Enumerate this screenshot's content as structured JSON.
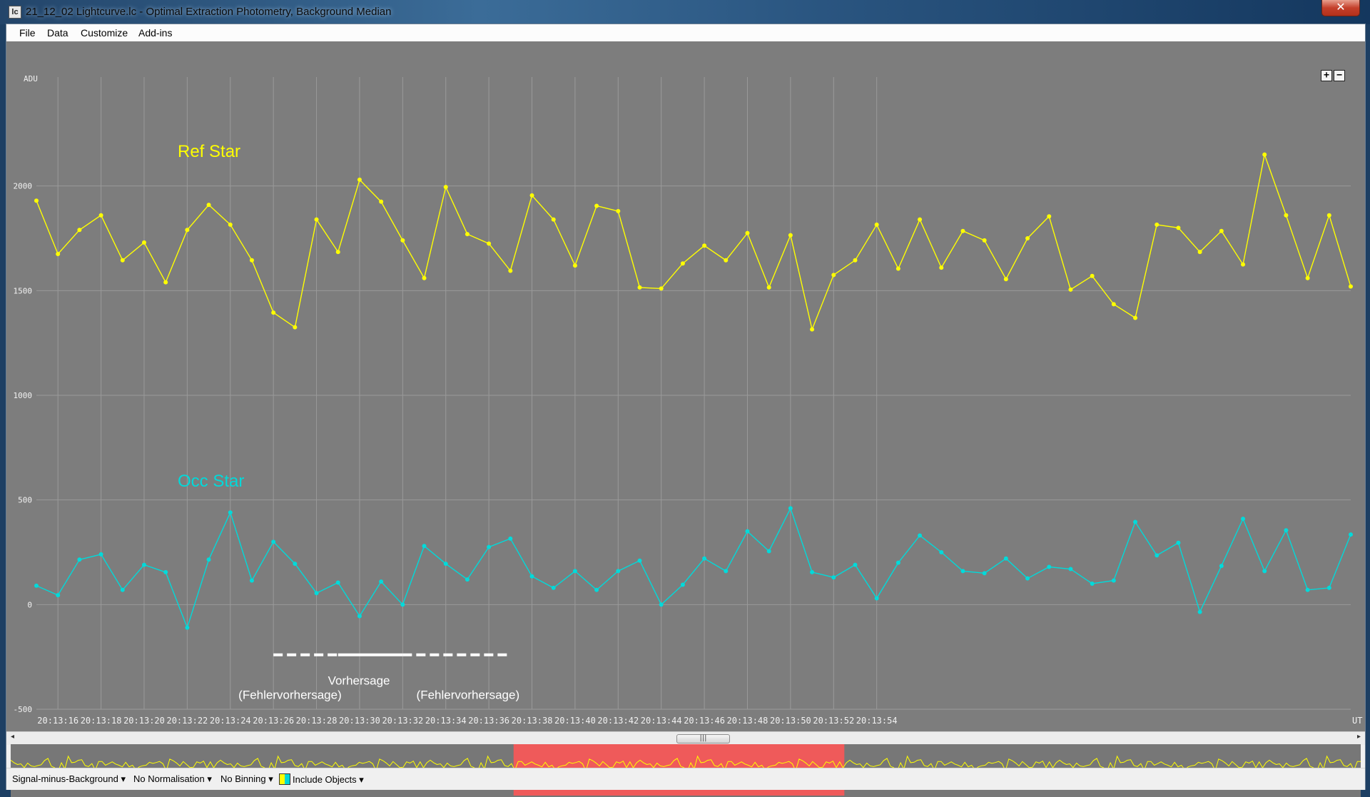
{
  "window": {
    "title": "21_12_02 Lightcurve.lc - Optimal Extraction Photometry, Background Median",
    "icon_name": "app-icon",
    "close_label": "✕"
  },
  "menu": {
    "items": [
      "File",
      "Data",
      "Customize",
      "Add-ins"
    ]
  },
  "zoom": {
    "plus": "+",
    "minus": "−"
  },
  "colors": {
    "ref": "#ffff00",
    "occ": "#00dada",
    "grid": "#9a9a9a",
    "plot_bg": "#7d7d7d",
    "highlight": "#ef5a5a",
    "annotation": "#ffffff"
  },
  "chart_data": {
    "type": "line",
    "ylabel": "ADU",
    "xlabel": "UT",
    "ylim": [
      -500,
      2500
    ],
    "yticks": [
      -500,
      0,
      500,
      1000,
      1500,
      2000
    ],
    "ytick_labels": [
      "-500",
      "0",
      "500",
      "1000",
      "1500",
      "2000"
    ],
    "x_start": "20:13:15",
    "x_step_seconds": 1,
    "xticks": [
      "20:13:16",
      "20:13:18",
      "20:13:20",
      "20:13:22",
      "20:13:24",
      "20:13:26",
      "20:13:28",
      "20:13:30",
      "20:13:32",
      "20:13:34",
      "20:13:36",
      "20:13:38",
      "20:13:40",
      "20:13:42",
      "20:13:44",
      "20:13:46",
      "20:13:48",
      "20:13:50",
      "20:13:52",
      "20:13:54"
    ],
    "series": [
      {
        "name": "Ref Star",
        "values": [
          1930,
          1675,
          1790,
          1860,
          1645,
          1730,
          1540,
          1790,
          1910,
          1815,
          1645,
          1395,
          1325,
          1840,
          1685,
          2030,
          1925,
          1740,
          1560,
          1995,
          1770,
          1725,
          1595,
          1955,
          1840,
          1620,
          1905,
          1880,
          1515,
          1510,
          1630,
          1715,
          1645,
          1775,
          1515,
          1765,
          1315,
          1575,
          1645,
          1815,
          1605,
          1840,
          1610,
          1785,
          1740,
          1555,
          1750,
          1855,
          1505,
          1570,
          1435,
          1370,
          1815,
          1800,
          1685,
          1785,
          1625,
          2150,
          1860,
          1560,
          1860,
          1520
        ]
      },
      {
        "name": "Occ Star",
        "values": [
          90,
          45,
          215,
          240,
          70,
          190,
          155,
          -110,
          215,
          440,
          115,
          300,
          195,
          55,
          105,
          -55,
          110,
          0,
          280,
          195,
          120,
          275,
          315,
          135,
          80,
          160,
          70,
          160,
          210,
          0,
          95,
          220,
          160,
          350,
          255,
          460,
          155,
          130,
          190,
          30,
          200,
          330,
          250,
          160,
          150,
          220,
          125,
          180,
          170,
          100,
          115,
          395,
          235,
          295,
          -35,
          185,
          410,
          160,
          355,
          70,
          80,
          335
        ]
      }
    ],
    "annotations": {
      "ref_label": "Ref Star",
      "occ_label": "Occ Star",
      "prediction_label": "Vorhersage",
      "error_left": "(Fehlervorhersage)",
      "error_right": "(Fehlervorhersage)",
      "prediction_y": -240,
      "prediction_dashed_left_from": "20:13:26",
      "prediction_solid_from": "20:13:29",
      "prediction_solid_to": "20:13:32",
      "prediction_dashed_right_to": "20:13:37"
    }
  },
  "overview": {
    "highlight_start_fraction": 0.3725,
    "highlight_end_fraction": 0.6175
  },
  "status": {
    "signal": "Signal-minus-Background",
    "normalisation": "No Normalisation",
    "binning": "No Binning",
    "include": "Include Objects"
  }
}
